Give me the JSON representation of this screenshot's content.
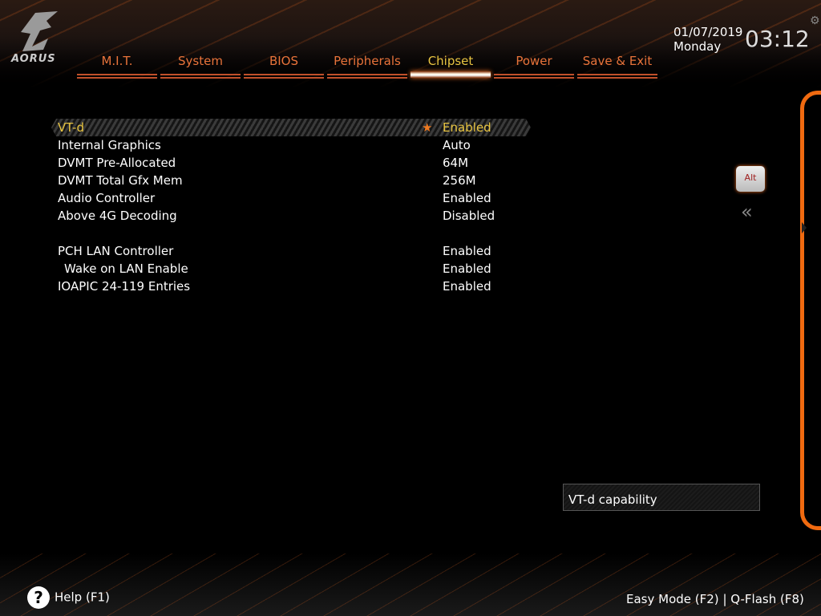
{
  "brand": "AORUS",
  "tabs": [
    {
      "label": "M.I.T."
    },
    {
      "label": "System"
    },
    {
      "label": "BIOS"
    },
    {
      "label": "Peripherals"
    },
    {
      "label": "Chipset",
      "active": true
    },
    {
      "label": "Power"
    },
    {
      "label": "Save & Exit"
    }
  ],
  "date": "01/07/2019",
  "day": "Monday",
  "time": "03:12",
  "settings": [
    {
      "label": "VT-d",
      "value": "Enabled",
      "selected": true
    },
    {
      "label": "Internal Graphics",
      "value": "Auto"
    },
    {
      "label": "DVMT Pre-Allocated",
      "value": "64M"
    },
    {
      "label": "DVMT Total Gfx Mem",
      "value": "256M"
    },
    {
      "label": "Audio Controller",
      "value": "Enabled"
    },
    {
      "label": "Above 4G Decoding",
      "value": "Disabled"
    },
    {
      "label": "PCH LAN Controller",
      "value": "Enabled"
    },
    {
      "label": "Wake on LAN Enable",
      "value": "Enabled"
    },
    {
      "label": "IOAPIC 24-119 Entries",
      "value": "Enabled"
    }
  ],
  "alt_key": "Alt",
  "help_text": "VT-d capability",
  "footer": {
    "help": "Help (F1)",
    "easy_mode": "Easy Mode (F2)",
    "separator": "|",
    "qflash": "Q-Flash (F8)"
  },
  "colors": {
    "accent": "#f06a10",
    "selected": "#e8c441",
    "tab": "#e8733a"
  }
}
